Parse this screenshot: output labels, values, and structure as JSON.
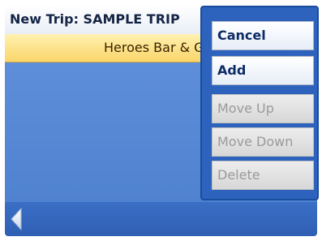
{
  "header": {
    "title": "New Trip: SAMPLE TRIP"
  },
  "trip_list": {
    "items": [
      {
        "label": "Heroes Bar & Grill"
      }
    ]
  },
  "menu": {
    "items": [
      {
        "label": "Cancel",
        "enabled": true
      },
      {
        "label": "Add",
        "enabled": true
      },
      {
        "label": "Move Up",
        "enabled": false
      },
      {
        "label": "Move Down",
        "enabled": false
      },
      {
        "label": "Delete",
        "enabled": false
      }
    ]
  },
  "nav": {
    "back_icon": "left-arrow-icon"
  },
  "colors": {
    "content_blue": "#5e8ed9",
    "highlight_yellow": "#fad56a",
    "menu_blue": "#2d63bd",
    "title_navy": "#142445"
  }
}
